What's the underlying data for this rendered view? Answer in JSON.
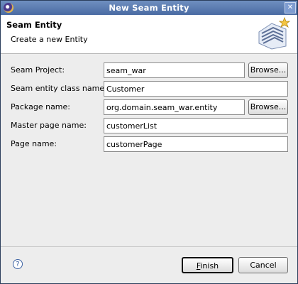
{
  "window": {
    "title": "New Seam Entity"
  },
  "header": {
    "title": "Seam Entity",
    "description": "Create a new Entity"
  },
  "icons": {
    "app": "eclipse-icon",
    "close": "close-icon",
    "wizard": "seam-wizard-icon",
    "help": "help-icon"
  },
  "form": {
    "seam_project": {
      "label": "Seam Project:",
      "value": "seam_war",
      "browse_label": "Browse..."
    },
    "entity_class": {
      "label": "Seam entity class name:",
      "value": "Customer"
    },
    "package": {
      "label": "Package name:",
      "value": "org.domain.seam_war.entity",
      "browse_label": "Browse..."
    },
    "master_page": {
      "label": "Master page name:",
      "value": "customerList"
    },
    "page": {
      "label": "Page name:",
      "value": "customerPage"
    }
  },
  "footer": {
    "help_label": "?",
    "finish_mnemonic": "F",
    "finish_rest": "inish",
    "cancel_label": "Cancel"
  }
}
